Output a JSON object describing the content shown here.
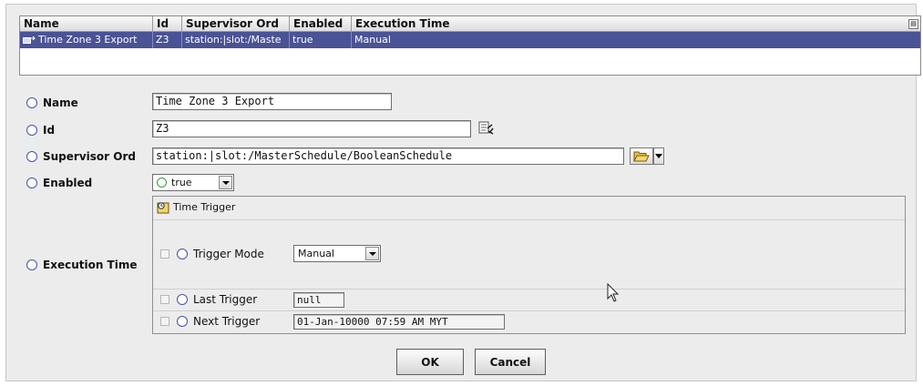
{
  "table": {
    "columns": [
      "Name",
      "Id",
      "Supervisor Ord",
      "Enabled",
      "Execution Time"
    ],
    "rows": [
      {
        "name": "Time Zone 3 Export",
        "id": "Z3",
        "supervisor_ord": "station:|slot:/Maste",
        "enabled": "true",
        "execution_time": "Manual"
      }
    ]
  },
  "form": {
    "name": {
      "label": "Name",
      "value": "Time Zone 3 Export"
    },
    "id": {
      "label": "Id",
      "value": "Z3"
    },
    "supervisor_ord": {
      "label": "Supervisor Ord",
      "value": "station:|slot:/MasterSchedule/BooleanSchedule"
    },
    "enabled": {
      "label": "Enabled",
      "value": "true"
    },
    "execution_time": {
      "label": "Execution Time",
      "header": "Time Trigger",
      "trigger_mode": {
        "label": "Trigger Mode",
        "value": "Manual"
      },
      "last_trigger": {
        "label": "Last Trigger",
        "value": "null"
      },
      "next_trigger": {
        "label": "Next Trigger",
        "value": "01-Jan-10000 07:59 AM MYT"
      }
    }
  },
  "buttons": {
    "ok": "OK",
    "cancel": "Cancel"
  },
  "colors": {
    "selection": "#4a5396",
    "radio": "#4453a8",
    "enabled_radio": "#3a9a3a"
  },
  "icons": [
    "schedule-export-icon",
    "column-chooser-icon",
    "id-lookup-icon",
    "folder-open-icon",
    "dropdown-arrow-icon",
    "time-trigger-icon",
    "mouse-cursor-icon"
  ]
}
